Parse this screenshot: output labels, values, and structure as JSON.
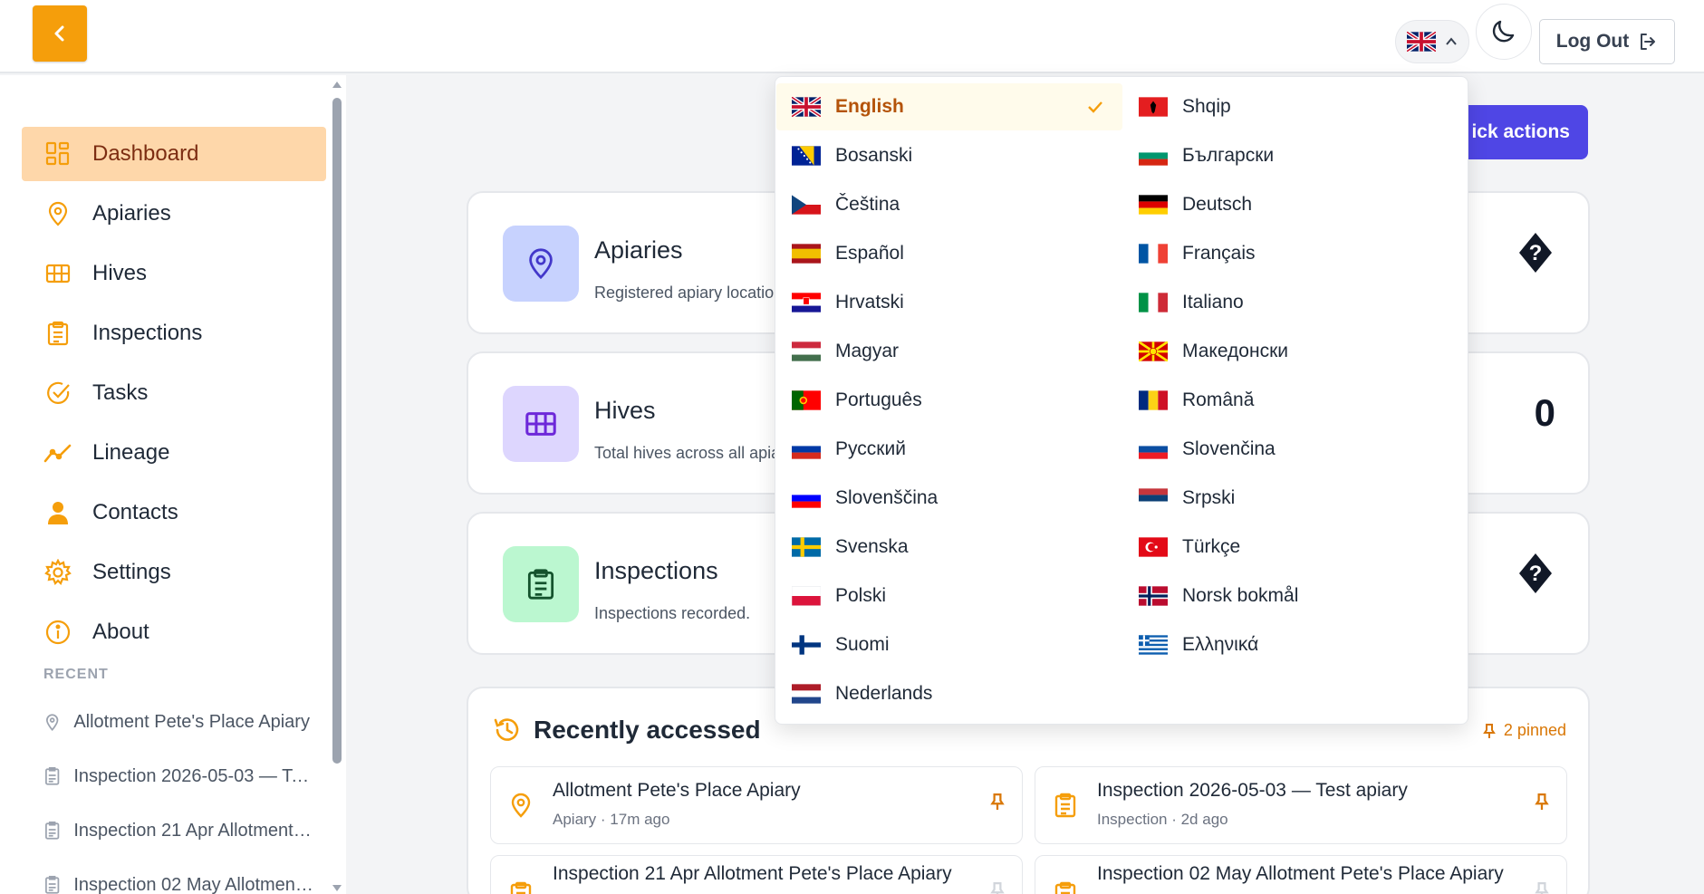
{
  "header": {
    "logout_label": "Log Out",
    "current_language_flag": "gb"
  },
  "sidebar": {
    "items": [
      {
        "label": "Dashboard",
        "icon": "dashboard-icon",
        "active": true
      },
      {
        "label": "Apiaries",
        "icon": "location-pin-icon"
      },
      {
        "label": "Hives",
        "icon": "hive-grid-icon"
      },
      {
        "label": "Inspections",
        "icon": "clipboard-icon"
      },
      {
        "label": "Tasks",
        "icon": "check-circle-icon"
      },
      {
        "label": "Lineage",
        "icon": "trend-line-icon"
      },
      {
        "label": "Contacts",
        "icon": "person-icon"
      },
      {
        "label": "Settings",
        "icon": "gear-icon"
      },
      {
        "label": "About",
        "icon": "info-icon"
      }
    ],
    "recent_heading": "RECENT",
    "recent": [
      {
        "label": "Allotment Pete's Place Apiary",
        "icon": "location-pin-icon"
      },
      {
        "label": "Inspection 2026-05-03 — Test apiary",
        "icon": "clipboard-icon"
      },
      {
        "label": "Inspection 21 Apr Allotment Pete's Place Apiary",
        "icon": "clipboard-icon"
      },
      {
        "label": "Inspection 02 May Allotment Pete's Place Apiary",
        "icon": "clipboard-icon"
      }
    ]
  },
  "main": {
    "quick_actions_label": "ick actions",
    "stats": [
      {
        "title": "Apiaries",
        "description": "Registered apiary locatio",
        "value": "?"
      },
      {
        "title": "Hives",
        "description": "Total hives across all apia",
        "value": "0"
      },
      {
        "title": "Inspections",
        "description": "Inspections recorded.",
        "value": "?"
      }
    ],
    "recently_accessed": {
      "title": "Recently accessed",
      "pinned_label": "2 pinned",
      "items": [
        {
          "title": "Allotment Pete's Place Apiary",
          "subtitle": "Apiary · 17m ago",
          "icon": "location-pin-icon",
          "pinned": true
        },
        {
          "title": "Inspection 2026-05-03 — Test apiary",
          "subtitle": "Inspection · 2d ago",
          "icon": "clipboard-icon",
          "pinned": true
        },
        {
          "title": "Inspection 21 Apr Allotment Pete's Place Apiary",
          "subtitle": "",
          "icon": "clipboard-icon",
          "pinned": false
        },
        {
          "title": "Inspection 02 May Allotment Pete's Place Apiary",
          "subtitle": "",
          "icon": "clipboard-icon",
          "pinned": false
        }
      ]
    }
  },
  "language_menu": {
    "left": [
      {
        "label": "English",
        "flag": "gb",
        "selected": true
      },
      {
        "label": "Bosanski",
        "flag": "ba"
      },
      {
        "label": "Čeština",
        "flag": "cz"
      },
      {
        "label": "Español",
        "flag": "es"
      },
      {
        "label": "Hrvatski",
        "flag": "hr"
      },
      {
        "label": "Magyar",
        "flag": "hu"
      },
      {
        "label": "Português",
        "flag": "pt"
      },
      {
        "label": "Русский",
        "flag": "ru"
      },
      {
        "label": "Slovenščina",
        "flag": "si"
      },
      {
        "label": "Svenska",
        "flag": "se"
      },
      {
        "label": "Polski",
        "flag": "pl"
      },
      {
        "label": "Suomi",
        "flag": "fi"
      },
      {
        "label": "Nederlands",
        "flag": "nl"
      }
    ],
    "right": [
      {
        "label": "Shqip",
        "flag": "al"
      },
      {
        "label": "Български",
        "flag": "bg"
      },
      {
        "label": "Deutsch",
        "flag": "de"
      },
      {
        "label": "Français",
        "flag": "fr"
      },
      {
        "label": "Italiano",
        "flag": "it"
      },
      {
        "label": "Македонски",
        "flag": "mk"
      },
      {
        "label": "Română",
        "flag": "ro"
      },
      {
        "label": "Slovenčina",
        "flag": "sk"
      },
      {
        "label": "Srpski",
        "flag": "rs"
      },
      {
        "label": "Türkçe",
        "flag": "tr"
      },
      {
        "label": "Norsk bokmål",
        "flag": "no"
      },
      {
        "label": "Ελληνικά",
        "flag": "gr"
      }
    ]
  },
  "colors": {
    "accent": "#f59e0b",
    "active_nav_bg": "#fed7aa",
    "primary": "#4f46e5"
  }
}
